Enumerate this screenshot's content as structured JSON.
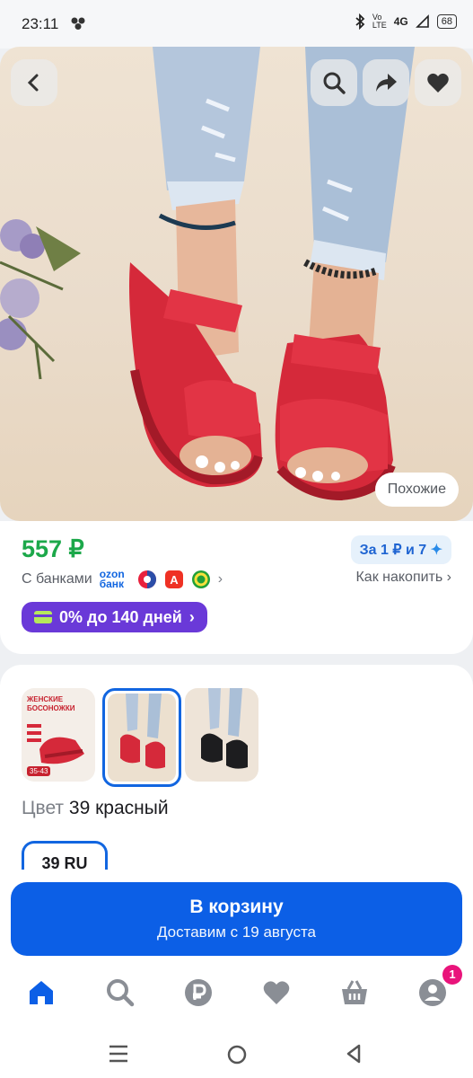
{
  "status_bar": {
    "time": "23:11",
    "network": "4G",
    "battery": "68"
  },
  "hero": {
    "similar_label": "Похожие"
  },
  "price_block": {
    "price": "557 ₽",
    "points_label": "За 1 ₽ и 7",
    "banks_label": "С банками",
    "ozon_bank": "ozon банк",
    "accumulate_label": "Как накопить",
    "installment_label": "0% до 140 дней"
  },
  "variants": {
    "thumb1_title": "ЖЕНСКИЕ БОСОНОЖКИ",
    "thumb1_sizes": "35-43",
    "color_label": "Цвет",
    "color_value": "39 красный",
    "size_label": "39 RU"
  },
  "cart": {
    "title": "В корзину",
    "delivery": "Доставим с 19 августа"
  },
  "tabbar": {
    "badge": "1"
  },
  "colors": {
    "price_green": "#1ca84a",
    "accent_blue": "#0c5fe6",
    "installment_purple": "#6a39d8",
    "badge_pink": "#e9147b"
  }
}
